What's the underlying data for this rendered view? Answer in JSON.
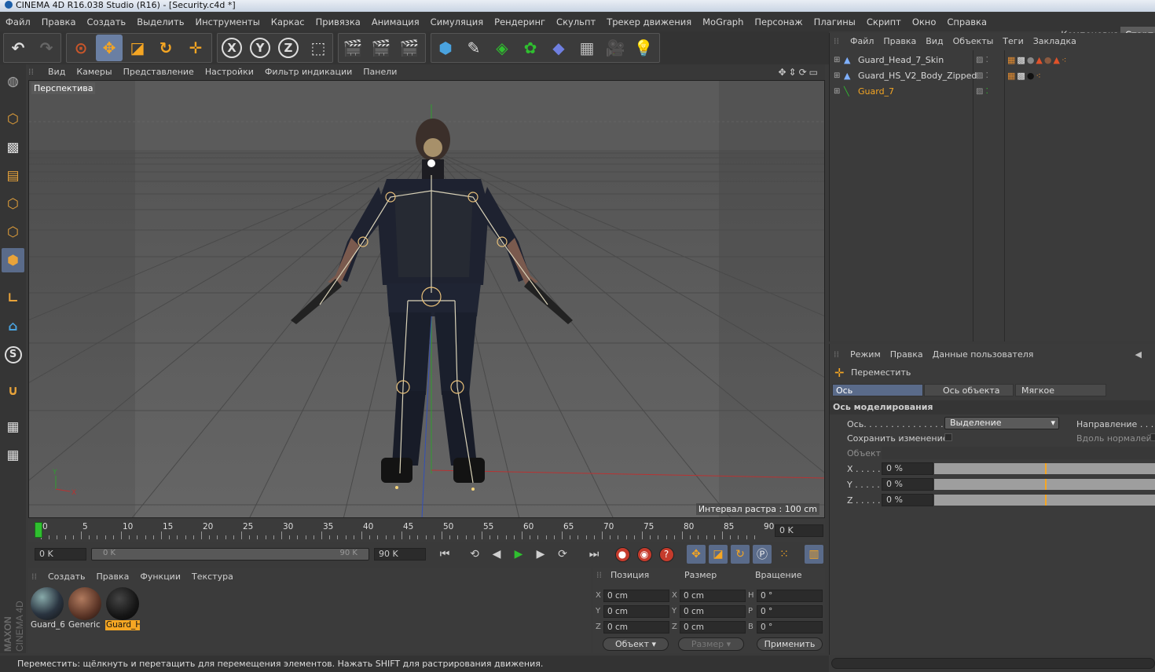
{
  "window": {
    "title": "CINEMA 4D R16.038 Studio (R16) - [Security.c4d *]"
  },
  "menubar": {
    "items": [
      "Файл",
      "Правка",
      "Создать",
      "Выделить",
      "Инструменты",
      "Каркас",
      "Привязка",
      "Анимация",
      "Симуляция",
      "Рендеринг",
      "Скульпт",
      "Трекер движения",
      "MoGraph",
      "Персонаж",
      "Плагины",
      "Скрипт",
      "Окно",
      "Справка"
    ],
    "layout_label": "Компоновка",
    "layout_value": "Старто"
  },
  "toolbar": {
    "axis_x": "X",
    "axis_y": "Y",
    "axis_z": "Z"
  },
  "viewport": {
    "menu": [
      "Вид",
      "Камеры",
      "Представление",
      "Настройки",
      "Фильтр индикации",
      "Панели"
    ],
    "view_name": "Перспектива",
    "grid_interval": "Интервал растра : 100 cm",
    "axis_y": "Y",
    "axis_x": "X"
  },
  "timeline": {
    "ticks": [
      "0",
      "5",
      "10",
      "15",
      "20",
      "25",
      "30",
      "35",
      "40",
      "45",
      "50",
      "55",
      "60",
      "65",
      "70",
      "75",
      "80",
      "85",
      "90"
    ],
    "current_frame_field": "0 K"
  },
  "playback": {
    "start_field": "0 K",
    "range_start": "0 K",
    "range_end": "90 K",
    "end_field": "90 K"
  },
  "materials": {
    "menu": [
      "Создать",
      "Правка",
      "Функции",
      "Текстура"
    ],
    "items": [
      {
        "name": "Guard_6"
      },
      {
        "name": "Generic"
      },
      {
        "name": "Guard_H"
      }
    ]
  },
  "coordinates": {
    "headers": {
      "position": "Позиция",
      "size": "Размер",
      "rotation": "Вращение"
    },
    "rows": [
      {
        "pos_label": "X",
        "pos": "0 cm",
        "size_label": "X",
        "size": "0 cm",
        "rot_label": "H",
        "rot": "0 °"
      },
      {
        "pos_label": "Y",
        "pos": "0 cm",
        "size_label": "Y",
        "size": "0 cm",
        "rot_label": "P",
        "rot": "0 °"
      },
      {
        "pos_label": "Z",
        "pos": "0 cm",
        "size_label": "Z",
        "size": "0 cm",
        "rot_label": "B",
        "rot": "0 °"
      }
    ],
    "mode_select": "Объект",
    "size_select": "Размер",
    "apply_button": "Применить"
  },
  "branding": {
    "maxon": "MAXON",
    "cinema": "CINEMA 4D"
  },
  "statusbar": {
    "text": "Переместить: щёлкнуть и перетащить для перемещения элементов. Нажать SHIFT для растрирования движения."
  },
  "object_manager": {
    "menu": [
      "Файл",
      "Правка",
      "Вид",
      "Объекты",
      "Теги",
      "Закладка"
    ],
    "objects": [
      {
        "name": "Guard_Head_7_Skin",
        "selected": false
      },
      {
        "name": "Guard_HS_V2_Body_Zipped",
        "selected": false
      },
      {
        "name": "Guard_7",
        "selected": true
      }
    ]
  },
  "attribute_manager": {
    "menu": [
      "Режим",
      "Правка",
      "Данные пользователя"
    ],
    "tool_name": "Переместить",
    "tabs": [
      "Ось моделирования",
      "Ось объекта",
      "Мягкое выделение"
    ],
    "section_title": "Ось моделирования",
    "axis_label": "Ось. . . . . . . . . . . . . . .",
    "axis_value": "Выделение",
    "direction_label": "Направление . . .",
    "keep_changes_label": "Сохранить изменение",
    "along_normals_label": "Вдоль нормалей",
    "object_label": "Объект",
    "x_label": "X . . . . .",
    "x_value": "0 %",
    "y_label": "Y . . . . .",
    "y_value": "0 %",
    "z_label": "Z . . . . .",
    "z_value": "0 %",
    "slider_fraction": 0.5
  },
  "colors": {
    "accent_orange": "#f5a623",
    "selection_blue": "#6a7fa3",
    "record_red": "#c53b2c",
    "play_green": "#2fbf2f"
  }
}
